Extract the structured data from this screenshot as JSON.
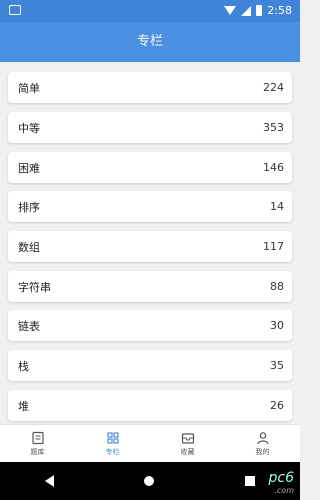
{
  "status": {
    "time": "2:58"
  },
  "header": {
    "title": "专栏"
  },
  "items": [
    {
      "label": "简单",
      "count": "224"
    },
    {
      "label": "中等",
      "count": "353"
    },
    {
      "label": "困难",
      "count": "146"
    },
    {
      "label": "排序",
      "count": "14"
    },
    {
      "label": "数组",
      "count": "117"
    },
    {
      "label": "字符串",
      "count": "88"
    },
    {
      "label": "链表",
      "count": "30"
    },
    {
      "label": "栈",
      "count": "35"
    },
    {
      "label": "堆",
      "count": "26"
    }
  ],
  "nav": {
    "tabs": [
      {
        "label": "题库",
        "icon": "book-icon"
      },
      {
        "label": "专栏",
        "icon": "grid-icon"
      },
      {
        "label": "收藏",
        "icon": "inbox-icon"
      },
      {
        "label": "我的",
        "icon": "user-icon"
      }
    ],
    "active_color": "#3f84d6"
  },
  "watermark": {
    "text": "pc6",
    "sub": ".com"
  },
  "colors": {
    "primary": "#4a8fe0",
    "status_bar": "#3f84d6"
  }
}
